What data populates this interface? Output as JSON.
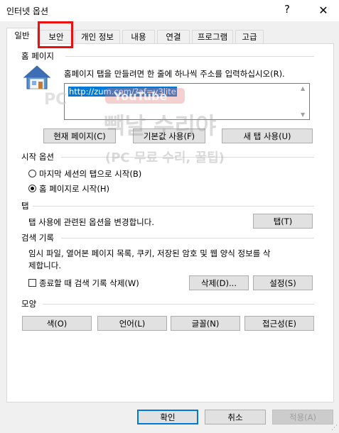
{
  "window": {
    "title": "인터넷 옵션",
    "help_glyph": "?",
    "close_glyph": "✕"
  },
  "tabs": [
    {
      "label": "일반"
    },
    {
      "label": "보안"
    },
    {
      "label": "개인 정보"
    },
    {
      "label": "내용"
    },
    {
      "label": "연결"
    },
    {
      "label": "프로그램"
    },
    {
      "label": "고급"
    }
  ],
  "homepage": {
    "section": "홈 페이지",
    "instruction": "홈페이지 탭을 만들려면 한 줄에 하나씩 주소를 입력하십시오(R).",
    "url": "http://zum.com/?af=v3lite",
    "btn_current": "현재 페이지(C)",
    "btn_default": "기본값 사용(F)",
    "btn_newtab": "새 탭 사용(U)"
  },
  "startup": {
    "section": "시작 옵션",
    "opt1": "마지막 세션의 탭으로 시작(B)",
    "opt2": "홈 페이지로 시작(H)",
    "selected": "opt2"
  },
  "tabs_section": {
    "section": "탭",
    "desc": "탭 사용에 관련된 옵션을 변경합니다.",
    "btn": "탭(T)"
  },
  "history": {
    "section": "검색 기록",
    "desc1": "임시 파일, 열어본 페이지 목록, 쿠키, 저장된 암호 및 웹 양식 정보를 삭",
    "desc2": "제합니다.",
    "checkbox": "종료할 때 검색 기록 삭제(W)",
    "btn_delete": "삭제(D)...",
    "btn_settings": "설정(S)"
  },
  "appearance": {
    "section": "모양",
    "btn_colors": "색(O)",
    "btn_lang": "언어(L)",
    "btn_fonts": "글꼴(N)",
    "btn_access": "접근성(E)"
  },
  "footer": {
    "ok": "확인",
    "cancel": "취소",
    "apply": "적용(A)"
  },
  "watermark": {
    "line1": "PC",
    "line2": "YouTube",
    "line3": "빽날 수리야",
    "line4": "(PC 무료 수리, 꿀팁)"
  },
  "colors": {
    "highlight": "#e81010",
    "selection": "#0078d7"
  }
}
